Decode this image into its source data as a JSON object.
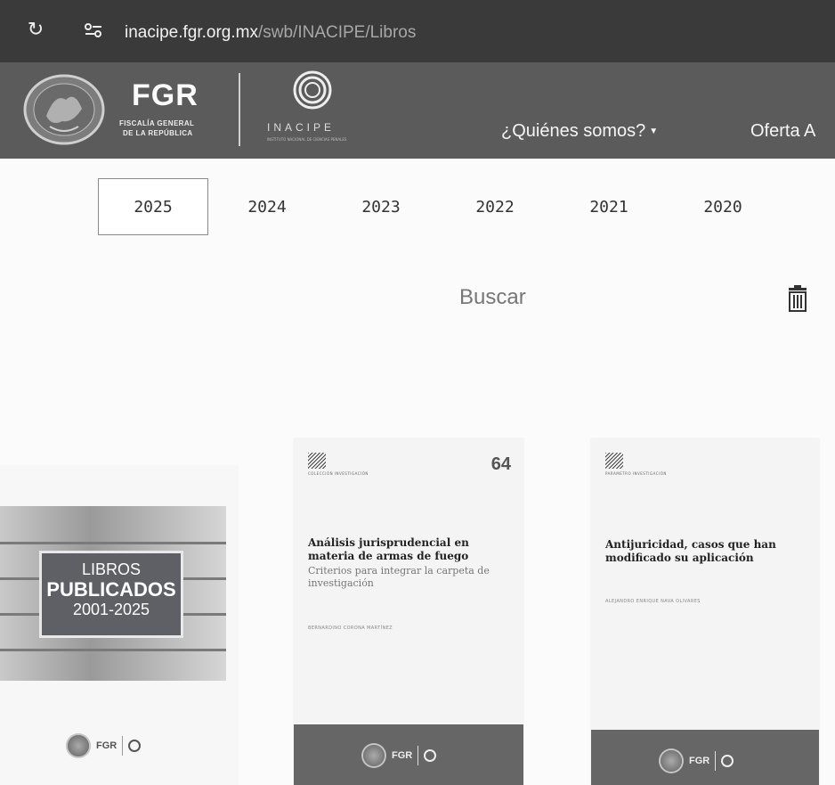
{
  "browser": {
    "url_host": "inacipe.fgr.org.mx",
    "url_path": "/swb/INACIPE/Libros"
  },
  "header": {
    "fgr_title": "FGR",
    "fgr_subtitle_1": "FISCALÍA GENERAL",
    "fgr_subtitle_2": "DE LA REPÚBLICA",
    "inacipe_name": "INACIPE",
    "inacipe_sub": "INSTITUTO NACIONAL DE CIENCIAS PENALES",
    "nav": [
      {
        "label": "¿Quiénes somos?"
      },
      {
        "label": "Oferta A"
      }
    ]
  },
  "years": {
    "selected": "2025",
    "items": [
      "2025",
      "2024",
      "2023",
      "2022",
      "2021",
      "2020"
    ]
  },
  "search": {
    "label": "Buscar",
    "clear_icon": "trash-icon"
  },
  "books": [
    {
      "kind": "promo",
      "line1": "LIBROS",
      "line2": "PUBLICADOS",
      "line3": "2001-2025",
      "logo_fgr": "FGR"
    },
    {
      "kind": "book",
      "collection": "COLECCIÓN INVESTIGACIÓN",
      "number": "64",
      "title": "Análisis jurisprudencial en materia de armas de fuego",
      "subtitle": "Criterios para integrar la carpeta de investigación",
      "author": "BERNARDINO CORONA MARTÍNEZ",
      "logo_fgr": "FGR"
    },
    {
      "kind": "book",
      "collection": "PARAMETRO INVESTIGACIÓN",
      "title": "Antijuricidad, casos que han modificado su aplicación",
      "author": "ALEJANDRO ENRIQUE NAVA OLIVARES",
      "logo_fgr": "FGR"
    }
  ]
}
